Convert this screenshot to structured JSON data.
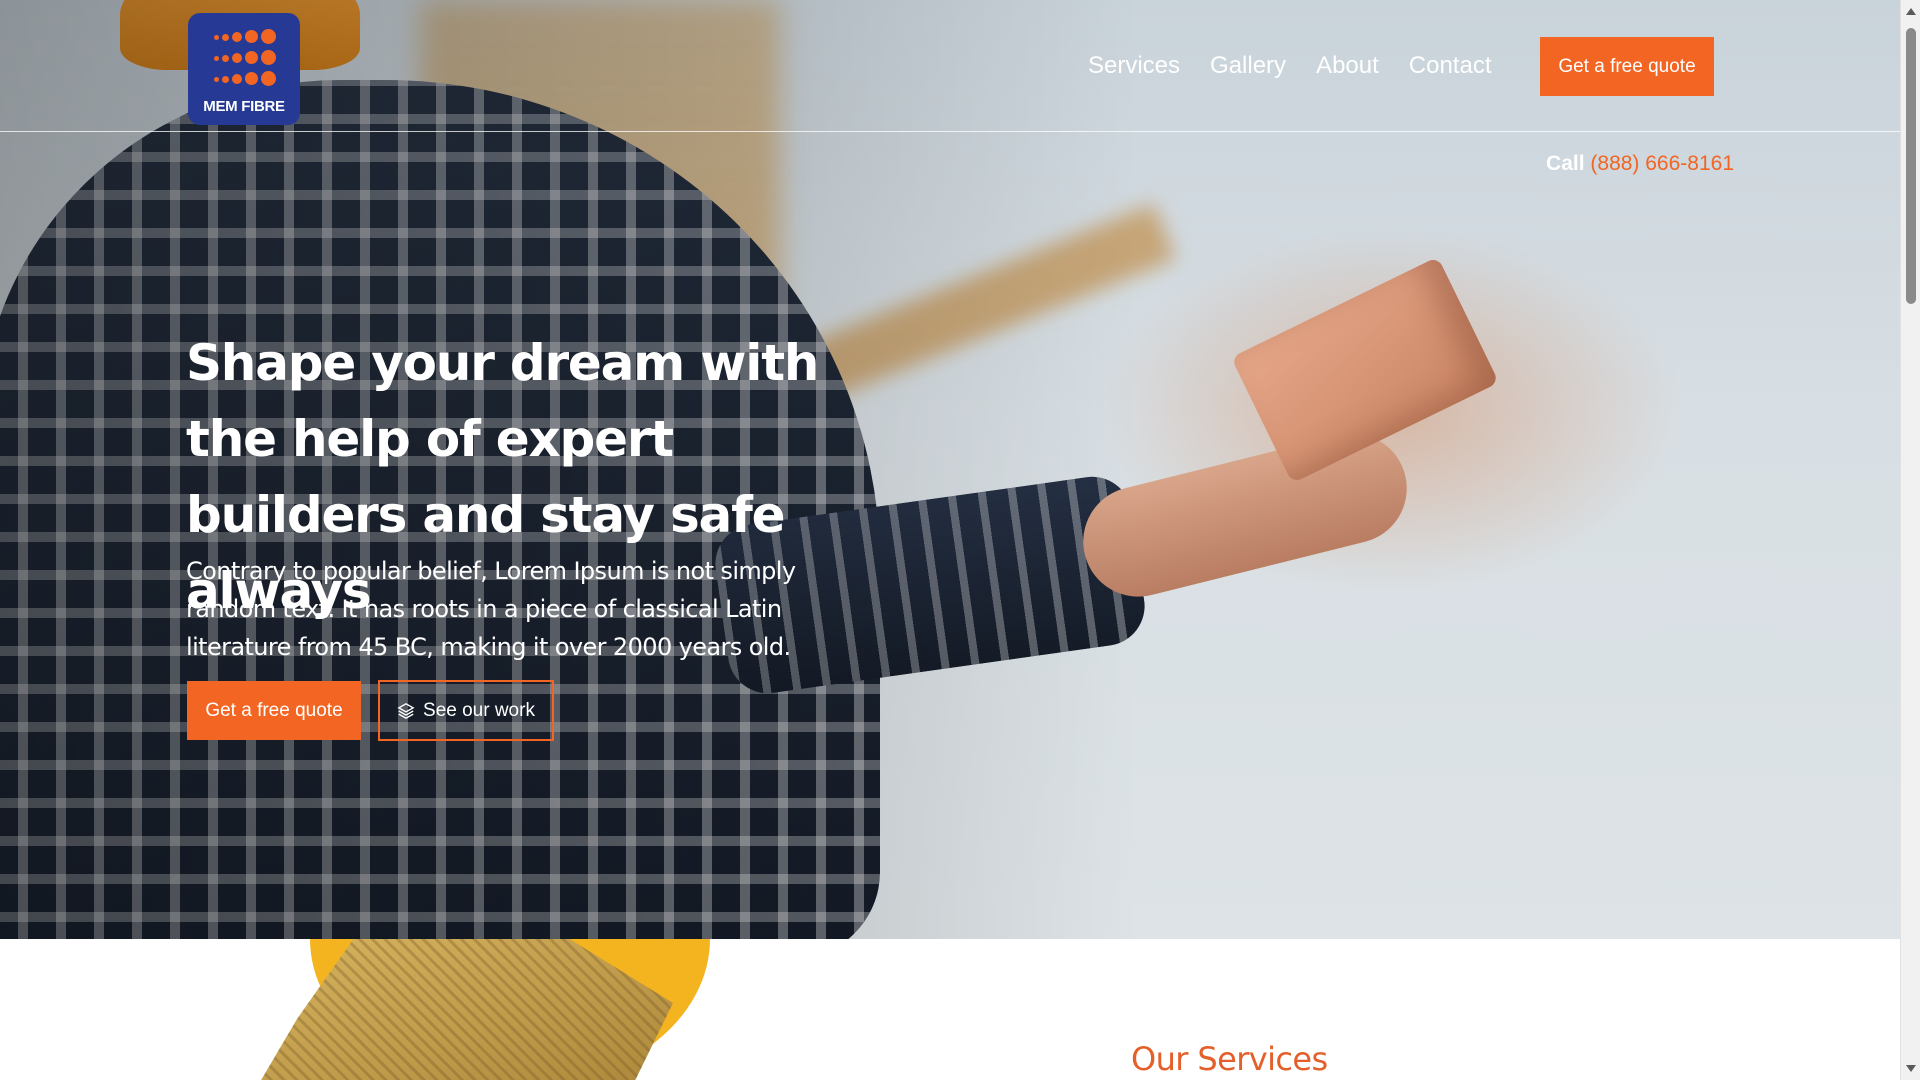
{
  "brand": {
    "name": "MEM FIBRE",
    "accent": "#f26522",
    "logo_bg": "#263a95",
    "logo_icon": "dot-grid-logo"
  },
  "nav": {
    "items": [
      {
        "label": "Services"
      },
      {
        "label": "Gallery"
      },
      {
        "label": "About"
      },
      {
        "label": "Contact"
      }
    ],
    "cta_label": "Get a free quote"
  },
  "call": {
    "label": "Call",
    "phone": "(888) 666-8161"
  },
  "hero": {
    "title": "Shape your dream with the help of expert builders and stay safe always",
    "description": "Contrary to popular belief, Lorem Ipsum is not simply random text. It has roots in a piece of classical Latin literature from 45 BC, making it over 2000 years old.",
    "primary_button": "Get a free quote",
    "secondary_button": "See our work",
    "secondary_icon": "layers-icon"
  },
  "services": {
    "heading": "Our Services",
    "heading_color": "#e4602b"
  }
}
